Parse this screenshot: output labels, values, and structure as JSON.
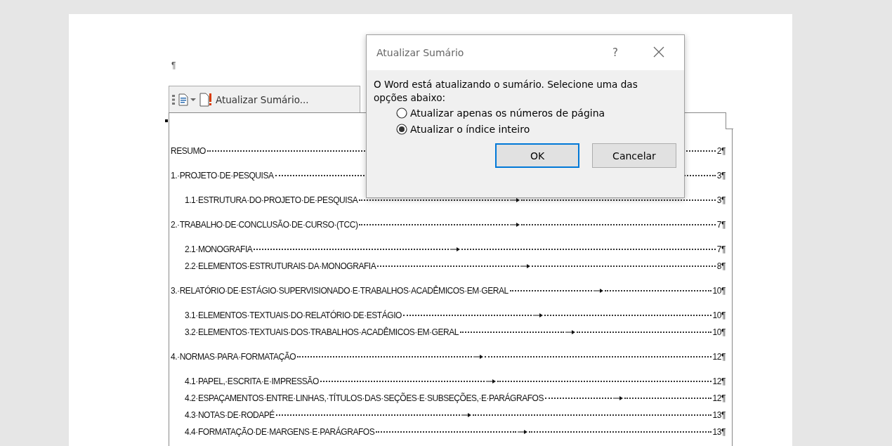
{
  "document": {
    "pilcrow": "¶"
  },
  "toc_toolbar": {
    "update_button": "Atualizar Sumário..."
  },
  "toc": {
    "entries": [
      {
        "title": "RESUMO",
        "page": "2¶",
        "tab_mark": false
      },
      {
        "title": "1.·PROJETO·DE·PESQUISA",
        "page": "3¶",
        "tab_mark": false,
        "children": [
          {
            "title": "1.1·ESTRUTURA·DO·PROJETO·DE·PESQUISA",
            "page": "3¶",
            "tab_mark": true
          }
        ]
      },
      {
        "title": "2.·TRABALHO·DE·CONCLUSÃO·DE·CURSO·(TCC)",
        "page": "7¶",
        "tab_mark": true,
        "children": [
          {
            "title": "2.1·MONOGRAFIA",
            "page": "7¶",
            "tab_mark": true
          },
          {
            "title": "2.2·ELEMENTOS·ESTRUTURAIS·DA·MONOGRAFIA",
            "page": "8¶",
            "tab_mark": true
          }
        ]
      },
      {
        "title": "3.·RELATÓRIO·DE·ESTÁGIO·SUPERVISIONADO·E·TRABALHOS·ACADÊMICOS·EM·GERAL",
        "page": "10¶",
        "tab_mark": true,
        "children": [
          {
            "title": "3.1·ELEMENTOS·TEXTUAIS·DO·RELATÓRIO·DE·ESTÁGIO",
            "page": "10¶",
            "tab_mark": true
          },
          {
            "title": "3.2·ELEMENTOS·TEXTUAIS·DOS·TRABALHOS·ACADÊMICOS·EM·GERAL",
            "page": "10¶",
            "tab_mark": true
          }
        ]
      },
      {
        "title": "4.·NORMAS·PARA·FORMATAÇÃO",
        "page": "12¶",
        "tab_mark": true,
        "children": [
          {
            "title": "4.1·PAPEL,·ESCRITA·E·IMPRESSÃO",
            "page": "12¶",
            "tab_mark": true
          },
          {
            "title": "4.2·ESPAÇAMENTOS·ENTRE·LINHAS,·TÍTULOS·DAS·SEÇÕES·E·SUBSEÇÕES,·E·PARÁGRAFOS",
            "page": "12¶",
            "tab_mark": true
          },
          {
            "title": "4.3·NOTAS·DE·RODAPÉ",
            "page": "13¶",
            "tab_mark": true
          },
          {
            "title": "4.4·FORMATAÇÃO·DE·MARGENS·E·PARÁGRAFOS",
            "page": "13¶",
            "tab_mark": true
          }
        ]
      }
    ]
  },
  "dialog": {
    "title": "Atualizar Sumário",
    "help": "?",
    "message": "O Word está atualizando o sumário. Selecione uma das opções abaixo:",
    "options": [
      {
        "label": "Atualizar apenas os números de página",
        "selected": false
      },
      {
        "label": "Atualizar o índice inteiro",
        "selected": true
      }
    ],
    "buttons": [
      {
        "label": "OK",
        "default": true
      },
      {
        "label": "Cancelar",
        "default": false
      }
    ]
  }
}
